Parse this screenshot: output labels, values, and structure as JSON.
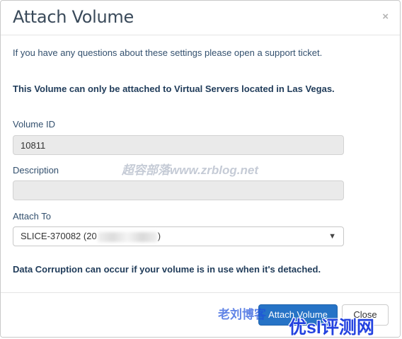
{
  "modal": {
    "title": "Attach Volume",
    "close_symbol": "×",
    "info_text": "If you have any questions about these settings please open a support ticket.",
    "notice_text": "This Volume can only be attached to Virtual Servers located in Las Vegas.",
    "volume_id": {
      "label": "Volume ID",
      "value": "10811"
    },
    "description": {
      "label": "Description",
      "value": ""
    },
    "attach_to": {
      "label": "Attach To",
      "value_prefix": "SLICE-370082 (20",
      "value_suffix": ")"
    },
    "warning_text": "Data Corruption can occur if your volume is in use when it's detached.",
    "buttons": {
      "attach": "Attach Volume",
      "cancel": "Close"
    }
  },
  "watermarks": {
    "center": "超容部落www.zrblog.net",
    "footer_left": "老刘博客",
    "footer_right": "优sl评测网"
  },
  "colors": {
    "primary_button": "#2673c6",
    "title": "#3a4a5a"
  },
  "icons": {
    "close": "close-icon",
    "dropdown": "chevron-down-icon"
  }
}
